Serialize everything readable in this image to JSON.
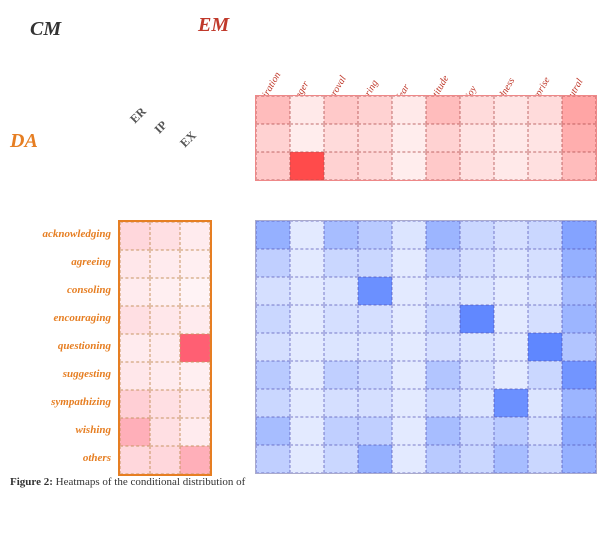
{
  "labels": {
    "cm": "CM",
    "em": "EM",
    "da": "DA",
    "er": "ER",
    "ip": "IP",
    "ex": "EX"
  },
  "columns": [
    "admiration",
    "anger",
    "approval",
    "caring",
    "fear",
    "gratitude",
    "joy",
    "sadness",
    "surprise",
    "neutral"
  ],
  "rows": [
    "acknowledging",
    "agreeing",
    "consoling",
    "encouraging",
    "questioning",
    "suggesting",
    "sympathizing",
    "wishing",
    "others"
  ],
  "em_heatmap": [
    [
      0.15,
      0.05,
      0.12,
      0.1,
      0.05,
      0.15,
      0.08,
      0.06,
      0.08,
      0.2
    ],
    [
      0.1,
      0.04,
      0.08,
      0.08,
      0.04,
      0.1,
      0.06,
      0.05,
      0.06,
      0.18
    ],
    [
      0.12,
      0.45,
      0.1,
      0.09,
      0.04,
      0.12,
      0.07,
      0.05,
      0.07,
      0.15
    ]
  ],
  "da_heatmap": [
    [
      0.1,
      0.08,
      0.05
    ],
    [
      0.06,
      0.05,
      0.04
    ],
    [
      0.05,
      0.04,
      0.03
    ],
    [
      0.08,
      0.06,
      0.05
    ],
    [
      0.05,
      0.05,
      0.45
    ],
    [
      0.06,
      0.05,
      0.04
    ],
    [
      0.12,
      0.08,
      0.06
    ],
    [
      0.2,
      0.08,
      0.05
    ],
    [
      0.1,
      0.1,
      0.2
    ]
  ],
  "blue_heatmap": [
    [
      0.3,
      0.08,
      0.25,
      0.2,
      0.1,
      0.28,
      0.15,
      0.12,
      0.15,
      0.35
    ],
    [
      0.18,
      0.08,
      0.15,
      0.15,
      0.08,
      0.18,
      0.12,
      0.1,
      0.12,
      0.3
    ],
    [
      0.12,
      0.08,
      0.1,
      0.42,
      0.08,
      0.12,
      0.1,
      0.08,
      0.1,
      0.25
    ],
    [
      0.15,
      0.08,
      0.12,
      0.12,
      0.08,
      0.15,
      0.45,
      0.08,
      0.12,
      0.28
    ],
    [
      0.12,
      0.08,
      0.1,
      0.1,
      0.08,
      0.12,
      0.1,
      0.08,
      0.48,
      0.22
    ],
    [
      0.2,
      0.08,
      0.18,
      0.15,
      0.08,
      0.22,
      0.12,
      0.08,
      0.15,
      0.4
    ],
    [
      0.15,
      0.08,
      0.12,
      0.12,
      0.08,
      0.15,
      0.1,
      0.42,
      0.1,
      0.28
    ],
    [
      0.25,
      0.08,
      0.18,
      0.18,
      0.08,
      0.25,
      0.15,
      0.2,
      0.12,
      0.32
    ],
    [
      0.18,
      0.08,
      0.15,
      0.3,
      0.08,
      0.2,
      0.15,
      0.25,
      0.15,
      0.3
    ]
  ],
  "caption": "Figure 2: Heatmaps of the conditional distribution of ..."
}
